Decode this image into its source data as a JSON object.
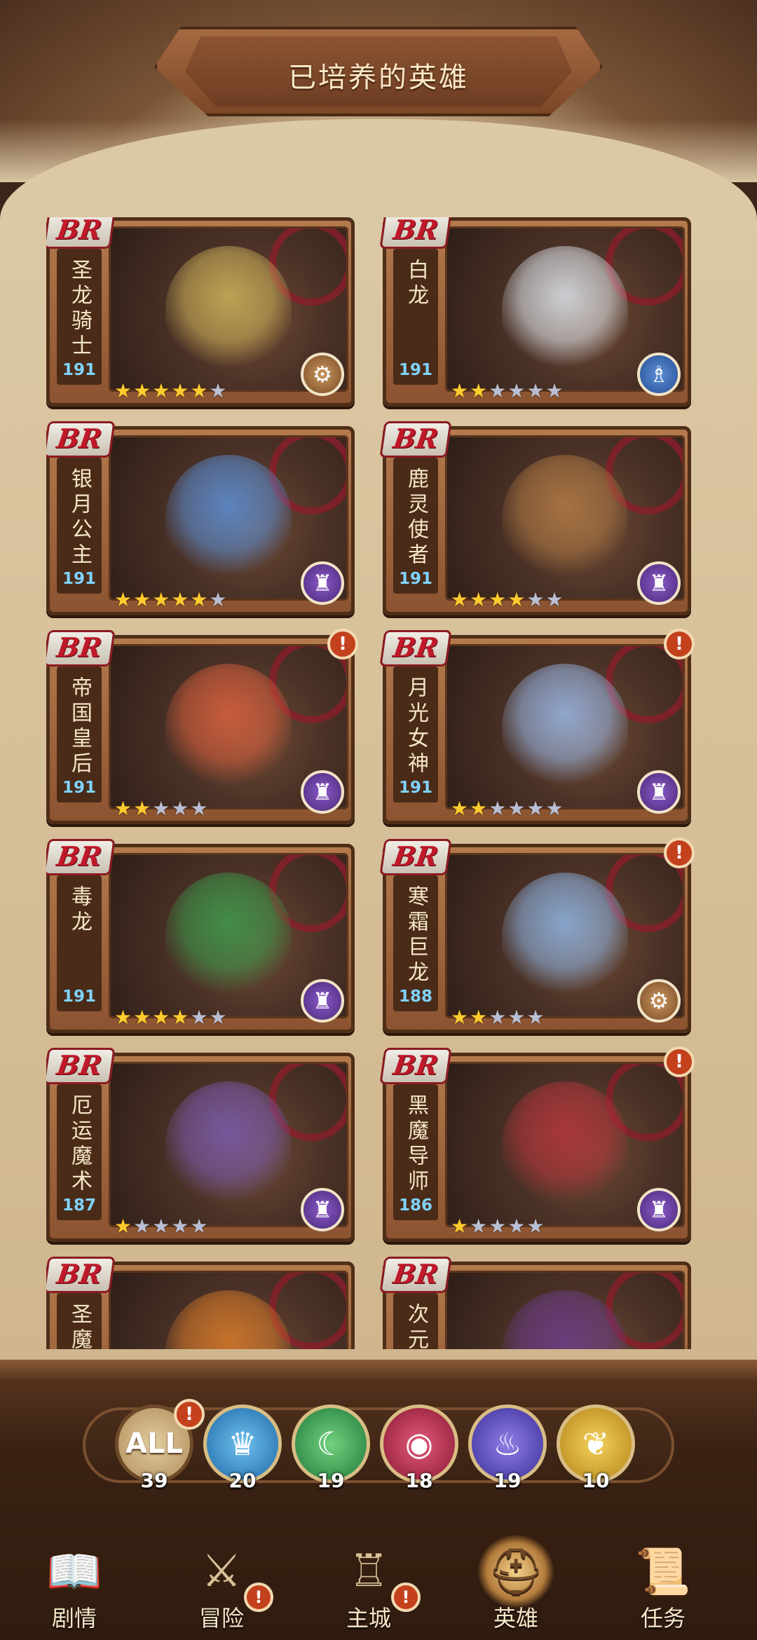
{
  "title": "已培养的英雄",
  "badge_label": "BR",
  "star_on": "★",
  "star_off": "★",
  "heroes": [
    {
      "name": "圣龙骑士",
      "level": "191",
      "stars": 5,
      "max_stars": 6,
      "class_icon": "cannon-icon",
      "class_color": "brown",
      "alert": false,
      "figure_color": "#cdb25a"
    },
    {
      "name": "白龙",
      "level": "191",
      "stars": 2,
      "max_stars": 6,
      "class_icon": "priest-icon",
      "class_color": "blue",
      "alert": false,
      "figure_color": "#dfe6ee"
    },
    {
      "name": "银月公主",
      "level": "191",
      "stars": 5,
      "max_stars": 6,
      "class_icon": "mage-icon",
      "class_color": "purple",
      "alert": false,
      "figure_color": "#5b8fd8"
    },
    {
      "name": "鹿灵使者",
      "level": "191",
      "stars": 4,
      "max_stars": 6,
      "class_icon": "mage-icon",
      "class_color": "purple",
      "alert": false,
      "figure_color": "#b07a45"
    },
    {
      "name": "帝国皇后",
      "level": "191",
      "stars": 2,
      "max_stars": 5,
      "class_icon": "mage-icon",
      "class_color": "purple",
      "alert": true,
      "figure_color": "#d9603e"
    },
    {
      "name": "月光女神",
      "level": "191",
      "stars": 2,
      "max_stars": 6,
      "class_icon": "mage-icon",
      "class_color": "purple",
      "alert": true,
      "figure_color": "#9ab9e8"
    },
    {
      "name": "毒龙",
      "level": "191",
      "stars": 4,
      "max_stars": 6,
      "class_icon": "mage-icon",
      "class_color": "purple",
      "alert": false,
      "figure_color": "#3b9a4c"
    },
    {
      "name": "寒霜巨龙",
      "level": "188",
      "stars": 2,
      "max_stars": 5,
      "class_icon": "cannon-icon",
      "class_color": "brown",
      "alert": true,
      "figure_color": "#8fb6e6"
    },
    {
      "name": "厄运魔术",
      "level": "187",
      "stars": 1,
      "max_stars": 5,
      "class_icon": "mage-icon",
      "class_color": "purple",
      "alert": false,
      "figure_color": "#7a5bb0"
    },
    {
      "name": "黑魔导师",
      "level": "186",
      "stars": 1,
      "max_stars": 5,
      "class_icon": "mage-icon",
      "class_color": "purple",
      "alert": true,
      "figure_color": "#b4343c"
    },
    {
      "name": "圣魔",
      "level": "",
      "stars": 0,
      "max_stars": 0,
      "class_icon": "",
      "class_color": "",
      "alert": false,
      "figure_color": "#d87a2a"
    },
    {
      "name": "次元",
      "level": "",
      "stars": 0,
      "max_stars": 0,
      "class_icon": "",
      "class_color": "",
      "alert": false,
      "figure_color": "#6a3c8a"
    }
  ],
  "filters": [
    {
      "label": "ALL",
      "count": "39",
      "icon": "all-icon"
    },
    {
      "label": "",
      "count": "20",
      "icon": "crown-icon"
    },
    {
      "label": "",
      "count": "19",
      "icon": "moon-icon"
    },
    {
      "label": "",
      "count": "18",
      "icon": "eye-icon"
    },
    {
      "label": "",
      "count": "19",
      "icon": "spirit-flame-icon"
    },
    {
      "label": "",
      "count": "10",
      "icon": "wings-icon"
    }
  ],
  "filter_alert": "!",
  "nav": [
    {
      "label": "剧情",
      "icon": "book-icon",
      "alert": false,
      "active": false
    },
    {
      "label": "冒险",
      "icon": "crossed-swords-icon",
      "alert": true,
      "active": false
    },
    {
      "label": "主城",
      "icon": "castle-icon",
      "alert": true,
      "active": false
    },
    {
      "label": "英雄",
      "icon": "helmet-icon",
      "alert": false,
      "active": true
    },
    {
      "label": "任务",
      "icon": "scroll-icon",
      "alert": false,
      "active": false
    }
  ],
  "alert_mark": "!"
}
